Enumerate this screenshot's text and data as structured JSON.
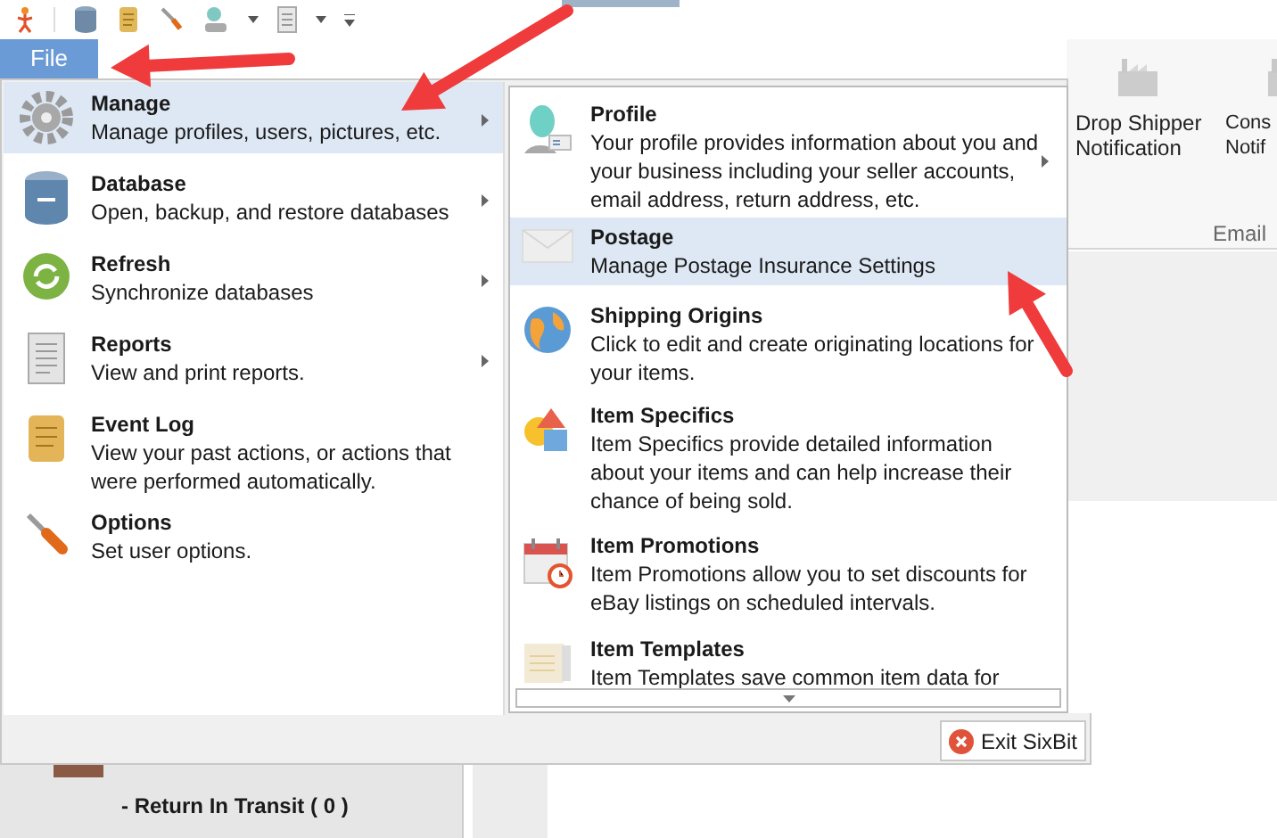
{
  "file_tab": {
    "label": "File",
    "selected": true
  },
  "menu": {
    "items": [
      {
        "label": "Manage",
        "description": "Manage profiles, users, pictures, etc.",
        "has_submenu": true,
        "selected": true
      },
      {
        "label": "Database",
        "description": "Open, backup, and restore databases",
        "has_submenu": true,
        "selected": false
      },
      {
        "label": "Refresh",
        "description": "Synchronize databases",
        "has_submenu": true,
        "selected": false
      },
      {
        "label": "Reports",
        "description": "View and print reports.",
        "has_submenu": true,
        "selected": false
      },
      {
        "label": "Event Log",
        "description": "View your past actions, or actions that were performed automatically.",
        "has_submenu": false,
        "selected": false
      },
      {
        "label": "Options",
        "description": "Set user options.",
        "has_submenu": false,
        "selected": false
      }
    ]
  },
  "submenu": {
    "items": [
      {
        "label": "Profile",
        "description": "Your profile provides information about you and your business including your seller accounts, email address, return address, etc.",
        "has_submenu": true,
        "selected": false
      },
      {
        "label": "Postage",
        "description": "Manage Postage Insurance Settings",
        "has_submenu": false,
        "selected": true
      },
      {
        "label": "Shipping Origins",
        "description": "Click to edit and create originating locations for your items.",
        "has_submenu": false,
        "selected": false
      },
      {
        "label": "Item Specifics",
        "description": "Item Specifics provide detailed information about your items and can help increase their chance of being sold.",
        "has_submenu": false,
        "selected": false
      },
      {
        "label": "Item Promotions",
        "description": "Item Promotions allow you to set discounts for eBay listings on scheduled intervals.",
        "has_submenu": false,
        "selected": false
      },
      {
        "label": "Item Templates",
        "description": "Item Templates save common item data for",
        "has_submenu": false,
        "selected": false
      }
    ]
  },
  "exit_button": {
    "label": "Exit SixBit"
  },
  "ribbon": {
    "buttons": [
      {
        "lines": [
          "Drop Shipper",
          "Notification"
        ]
      },
      {
        "lines": [
          "Cons",
          "Notif"
        ]
      }
    ],
    "group": "Email"
  },
  "sidebar": {
    "items": [
      "- Return In Transit ( 0 )"
    ]
  }
}
